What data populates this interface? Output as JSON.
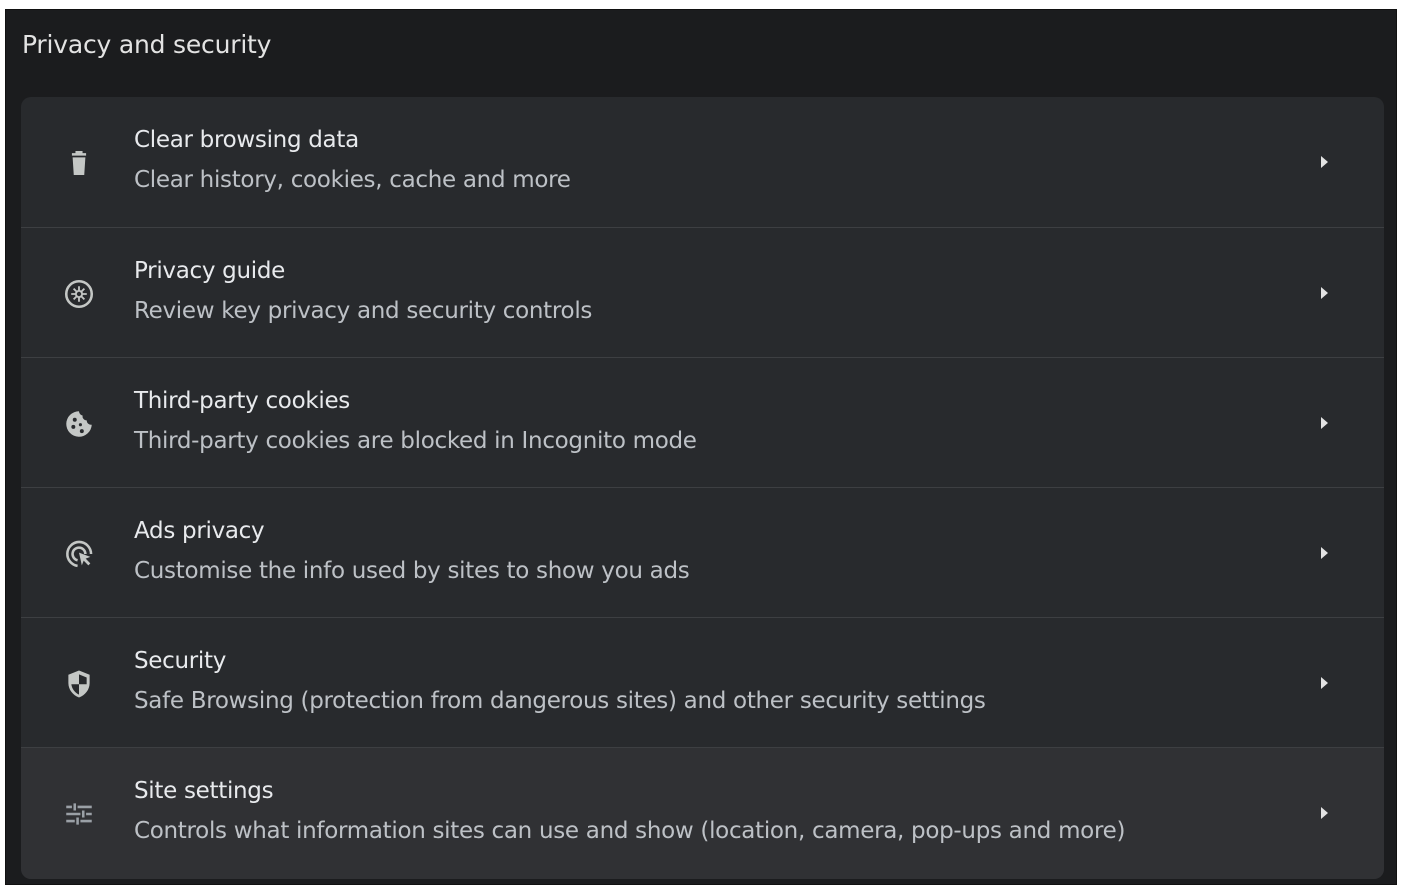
{
  "section": {
    "title": "Privacy and security"
  },
  "rows": [
    {
      "title": "Clear browsing data",
      "subtitle": "Clear history, cookies, cache and more",
      "icon": "trash-icon"
    },
    {
      "title": "Privacy guide",
      "subtitle": "Review key privacy and security controls",
      "icon": "privacy-guide-icon"
    },
    {
      "title": "Third-party cookies",
      "subtitle": "Third-party cookies are blocked in Incognito mode",
      "icon": "cookie-icon"
    },
    {
      "title": "Ads privacy",
      "subtitle": "Customise the info used by sites to show you ads",
      "icon": "ads-privacy-icon"
    },
    {
      "title": "Security",
      "subtitle": "Safe Browsing (protection from dangerous sites) and other security settings",
      "icon": "shield-icon"
    },
    {
      "title": "Site settings",
      "subtitle": "Controls what information sites can use and show (location, camera, pop-ups and more)",
      "icon": "tune-icon"
    }
  ],
  "colors": {
    "background": "#1b1c1e",
    "card": "#282a2d",
    "hover": "#303134",
    "text": "#e8eaed",
    "subtext": "#bdc1c6"
  }
}
